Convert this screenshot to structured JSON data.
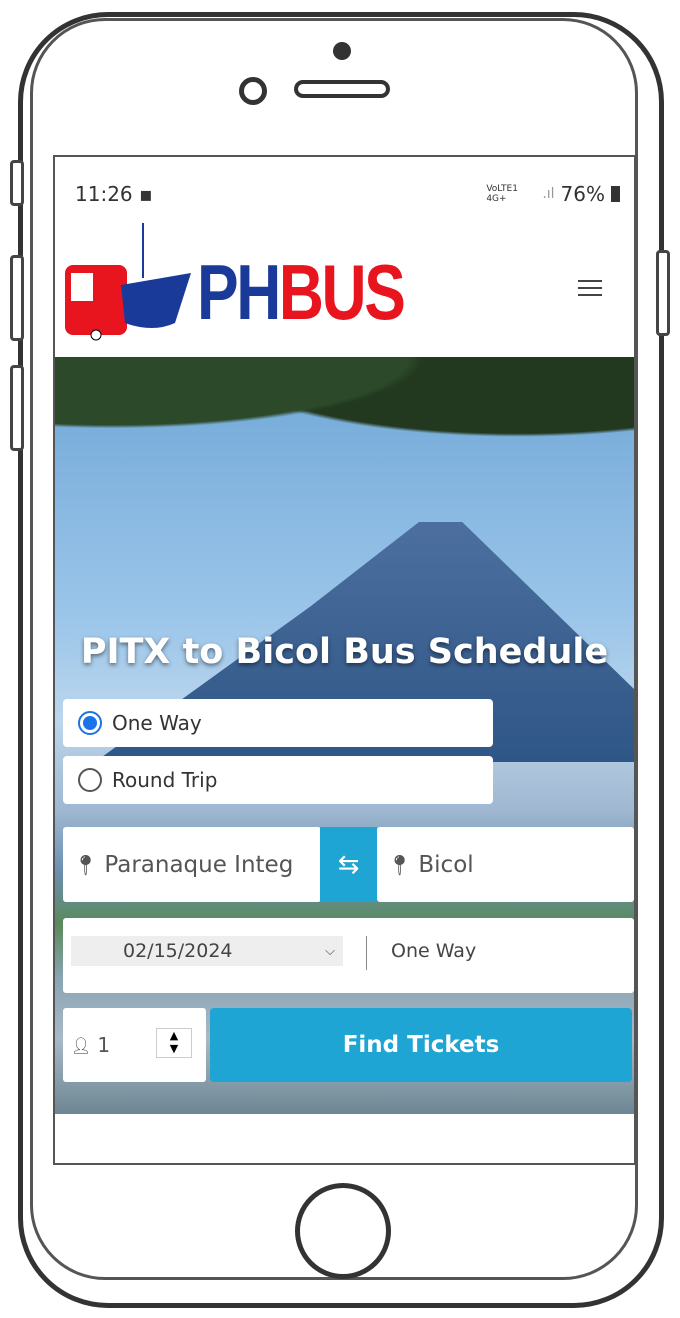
{
  "status_bar": {
    "time": "11:26",
    "network": "VoLTE1 4G+",
    "battery": "76%"
  },
  "header": {
    "logo_text_blue": "PH",
    "logo_text_red": "BUS",
    "menu_icon": "hamburger-icon"
  },
  "hero": {
    "title": "PITX to Bicol Bus Schedule"
  },
  "form": {
    "trip_types": [
      {
        "label": "One Way",
        "selected": true
      },
      {
        "label": "Round Trip",
        "selected": false
      }
    ],
    "origin": "Paranaque Integ",
    "destination": "Bicol",
    "date": "02/15/2024",
    "trip_display": "One Way",
    "passengers": "1",
    "submit_label": "Find Tickets"
  },
  "colors": {
    "accent": "#1ea5d3",
    "logo_blue": "#1a3a9a",
    "logo_red": "#e8141e",
    "radio": "#1a73e8"
  }
}
